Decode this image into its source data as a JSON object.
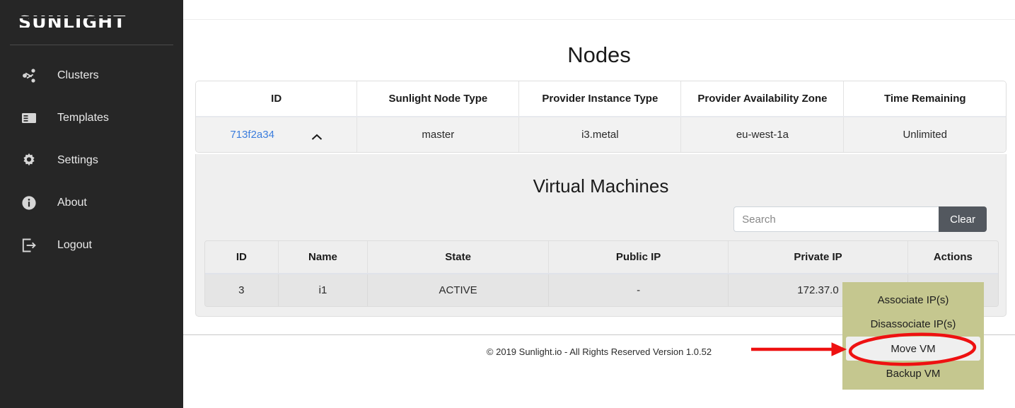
{
  "sidebar": {
    "brand": "SUNLIGHT",
    "items": [
      {
        "label": "Clusters",
        "icon": "share-icon"
      },
      {
        "label": "Templates",
        "icon": "window-icon"
      },
      {
        "label": "Settings",
        "icon": "gear-icon"
      },
      {
        "label": "About",
        "icon": "info-icon"
      },
      {
        "label": "Logout",
        "icon": "logout-icon"
      }
    ]
  },
  "nodes": {
    "title": "Nodes",
    "columns": [
      "ID",
      "Sunlight Node Type",
      "Provider Instance Type",
      "Provider Availability Zone",
      "Time Remaining"
    ],
    "rows": [
      {
        "id": "713f2a34",
        "expand_icon": "chevron-up-icon",
        "node_type": "master",
        "instance_type": "i3.metal",
        "availability_zone": "eu-west-1a",
        "time_remaining": "Unlimited"
      }
    ]
  },
  "vms": {
    "title": "Virtual Machines",
    "search": {
      "value": "",
      "placeholder": "Search"
    },
    "clear_label": "Clear",
    "columns": [
      "ID",
      "Name",
      "State",
      "Public IP",
      "Private IP",
      "Actions"
    ],
    "rows": [
      {
        "id": "3",
        "name": "i1",
        "state": "ACTIVE",
        "public_ip": "-",
        "private_ip": "172.37.0",
        "actions": ""
      }
    ]
  },
  "actions_menu": {
    "items": [
      {
        "label": "Associate IP(s)",
        "selected": false
      },
      {
        "label": "Disassociate IP(s)",
        "selected": false
      },
      {
        "label": "Move VM",
        "selected": true
      },
      {
        "label": "Backup VM",
        "selected": false
      }
    ]
  },
  "footer": {
    "text": "© 2019 Sunlight.io - All Rights Reserved Version 1.0.52"
  },
  "annotation": {
    "color": "#ee1111",
    "arrow": "points-to-move-vm",
    "ellipse": "circles-move-vm"
  },
  "colors": {
    "sidebar_bg": "#262626",
    "menu_bg": "#c5c78f",
    "link": "#3b7ddd",
    "clear_btn": "#53585f",
    "annotation_red": "#ee1111"
  }
}
